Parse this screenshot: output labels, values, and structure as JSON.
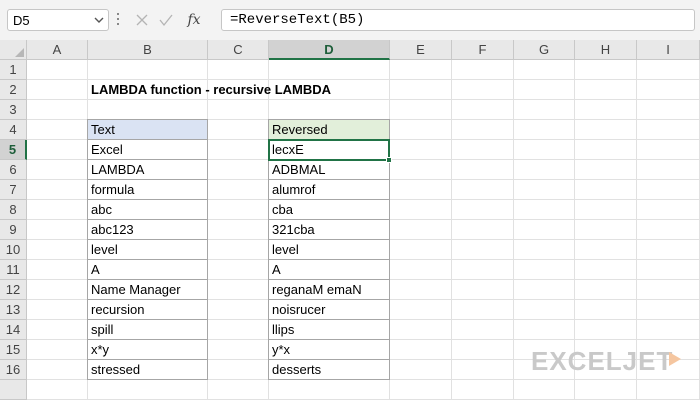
{
  "formula_bar": {
    "name_box": "D5",
    "fx_label": "fx",
    "formula": "=ReverseText(B5)"
  },
  "columns": [
    "A",
    "B",
    "C",
    "D",
    "E",
    "F",
    "G",
    "H",
    "I"
  ],
  "rows": [
    "1",
    "2",
    "3",
    "4",
    "5",
    "6",
    "7",
    "8",
    "9",
    "10",
    "11",
    "12",
    "13",
    "14",
    "15",
    "16"
  ],
  "selected": {
    "column": "D",
    "row": "5",
    "cell": "D5"
  },
  "sheet": {
    "title": "LAMBDA function - recursive LAMBDA",
    "text_header": "Text",
    "reversed_header": "Reversed",
    "text_values": [
      "Excel",
      "LAMBDA",
      "formula",
      "abc",
      "abc123",
      "level",
      "A",
      "Name Manager",
      "recursion",
      "spill",
      "x*y",
      "stressed"
    ],
    "reversed_values": [
      "lecxE",
      "ADBMAL",
      "alumrof",
      "cba",
      "321cba",
      "level",
      "A",
      "reganaM emaN",
      "noisrucer",
      "llips",
      "y*x",
      "desserts"
    ]
  },
  "watermark": {
    "text": "EXCELJET",
    "color": "#c9c9c9",
    "accent": "#f0a868"
  },
  "colors": {
    "excel_green": "#217346",
    "text_header_bg": "#dae3f3",
    "reversed_header_bg": "#e2efda"
  }
}
